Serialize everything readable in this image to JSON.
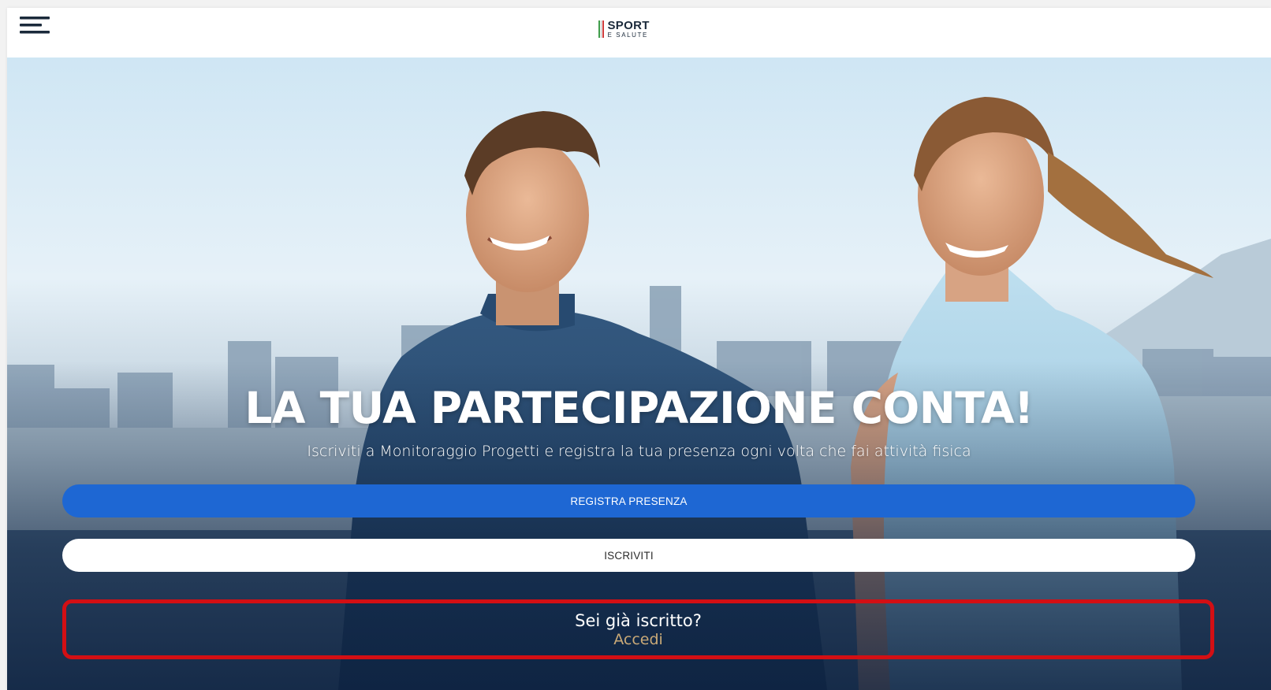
{
  "header": {
    "menu_icon": "hamburger-menu-icon",
    "logo": {
      "main": "SPORT",
      "sub": "E SALUTE",
      "stripe_colors": [
        "#3f9c4a",
        "#bdbdbd",
        "#cf3b3b"
      ]
    }
  },
  "hero": {
    "image": "two-runners-city-background",
    "title": "LA TUA PARTECIPAZIONE CONTA!",
    "subtitle": "Iscriviti a Monitoraggio Progetti e registra la tua presenza ogni volta che fai attività fisica",
    "primary_button": "REGISTRA PRESENZA",
    "secondary_button": "ISCRIVITI",
    "login_question": "Sei già iscritto?",
    "login_link": "Accedi"
  },
  "colors": {
    "primary": "#1e67d3",
    "accent_link": "#c9a977",
    "highlight_border": "#d30f14",
    "navy": "#1b2a3b"
  }
}
